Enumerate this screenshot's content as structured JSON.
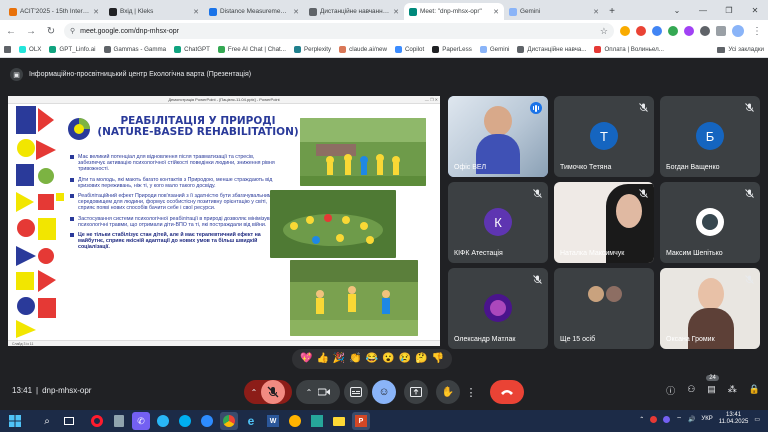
{
  "browser": {
    "tabs": [
      {
        "title": "ACIT'2025 - 15th Internati",
        "color": "#e8710a",
        "active": false
      },
      {
        "title": "Вхід | Kleks",
        "color": "#202124",
        "active": false
      },
      {
        "title": "Distance Measurement usi",
        "color": "#1a73e8",
        "active": false
      },
      {
        "title": "Дистанційне навчання з ГТ",
        "color": "#5f6368",
        "active": false
      },
      {
        "title": "Meet: \"dnp-mhsx-opr\"",
        "color": "#00897b",
        "active": true
      },
      {
        "title": "Gemini",
        "color": "#8ab4f8",
        "active": false
      }
    ],
    "url": "meet.google.com/dnp-mhsx-opr",
    "bookmarks": [
      {
        "label": "OLX",
        "color": "#23e5db"
      },
      {
        "label": "GPT_Linfo.ai",
        "color": "#10a37f"
      },
      {
        "label": "Gammas - Gamma",
        "color": "#5f6368"
      },
      {
        "label": "ChatGPT",
        "color": "#10a37f"
      },
      {
        "label": "Free AI Chat | Chat...",
        "color": "#34a853"
      },
      {
        "label": "Perplexity",
        "color": "#20808d"
      },
      {
        "label": "claude.ai/new",
        "color": "#d97757"
      },
      {
        "label": "Copilot",
        "color": "#3c8cff"
      },
      {
        "label": "PaperLess",
        "color": "#202124"
      },
      {
        "label": "Gemini",
        "color": "#8ab4f8"
      },
      {
        "label": "Дистанційне навча...",
        "color": "#5f6368"
      },
      {
        "label": "Оплата | Волиньел...",
        "color": "#e53935"
      }
    ],
    "all_bookmarks_label": "Усі закладки"
  },
  "meet": {
    "header_title": "Інформаційно-просвітницький центр Екологічна варта (Презентація)",
    "ppt_window_title": "Демонстрація PowerPoint - [Пацієнс-11.04.pptx] - PowerPoint",
    "ppt_status": "Слайд 3 із 11",
    "slide": {
      "title_line1": "РЕАБІЛІТАЦІЯ У ПРИРОДІ",
      "title_line2": "(NATURE-BASED REHABILITATION)",
      "bullets": [
        {
          "text": "Має великий потенціал для відновлення після травматизації та стресів, забезпечує активацію психологічної стійкості поведінки людини, зниження рівня тривожності.",
          "bold": false
        },
        {
          "text": "Діти та молодь, які мають багато контактів з Природою, менше страждають від кризових переживань, ніж ті, у кого мало такого досвіду.",
          "bold": false
        },
        {
          "text": "Реабілітаційний ефект Природи пов'язаний з її здатністю бути збагачувальним середовищем для людини, формує особистісну позитивну орієнтацію у світі, сприяє появі нових способів бачити себе і свої ресурси.",
          "bold": false
        },
        {
          "text": "Застосування системи психологічної реабілітації в природі дозволяє мінімізувати психологічні травми, що отримали діти-ВПО та ті, які постраждали від війни.",
          "bold": false
        },
        {
          "text": "Це не тільки стабілізує стан дітей, але й має терапевтичний ефект на майбутнє, сприяє якісній адаптації до нових умов та більш швидкій соціалізації.",
          "bold": true
        }
      ]
    },
    "participants": [
      {
        "name": "Офіс ВЕЛ",
        "initial": "",
        "avatar_color": "",
        "speaking": true
      },
      {
        "name": "Тимочко Тетяна",
        "initial": "Т",
        "avatar_color": "#1565c0",
        "speaking": false
      },
      {
        "name": "Богдан Ващенко",
        "initial": "Б",
        "avatar_color": "#1565c0",
        "speaking": false
      },
      {
        "name": "КІФК Атестація",
        "initial": "К",
        "avatar_color": "#5e35b1",
        "speaking": false
      },
      {
        "name": "Наталка Максимчук",
        "initial": "",
        "avatar_color": "",
        "speaking": false
      },
      {
        "name": "Максим Шепітько",
        "initial": "",
        "avatar_color": "",
        "speaking": false
      },
      {
        "name": "Олександр Матлак",
        "initial": "",
        "avatar_color": "",
        "speaking": false
      },
      {
        "name": "Ще 15 осіб",
        "initial": "",
        "avatar_color": "",
        "speaking": false
      },
      {
        "name": "Оксана Громик",
        "initial": "",
        "avatar_color": "",
        "speaking": false
      }
    ],
    "reactions": [
      "💖",
      "👍",
      "🎉",
      "👏",
      "😂",
      "😮",
      "😢",
      "🤔",
      "👎"
    ],
    "meeting_time": "13:41",
    "meeting_code": "dnp-mhsx-opr",
    "participant_count": "24"
  },
  "taskbar": {
    "lang": "УКР",
    "time": "13:41",
    "date": "11.04.2025"
  }
}
